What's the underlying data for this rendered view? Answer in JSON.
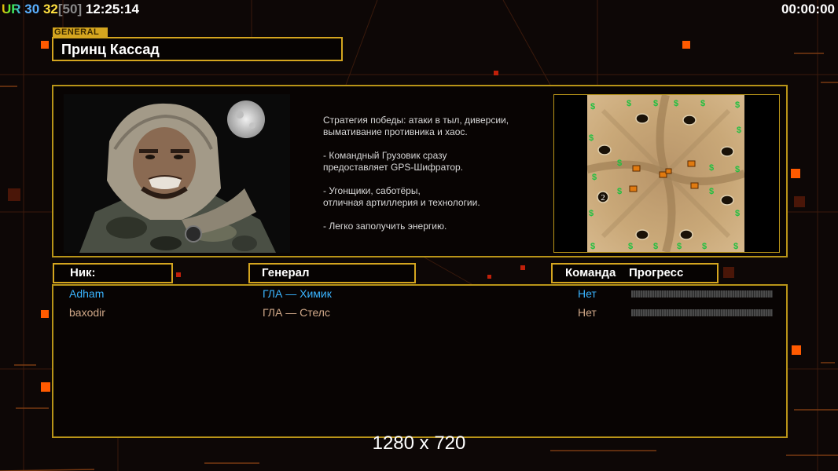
{
  "hud": {
    "prefix": "UR",
    "value_a": "30",
    "value_b": "32",
    "bracket_value": "[50]",
    "clock": "12:25:14",
    "timer": "00:00:00"
  },
  "general": {
    "tag": "GENERAL",
    "name": "Принц Кассад"
  },
  "description": [
    "Стратегия победы: атаки в тыл, диверсии,\n вымативание противника и хаос.",
    "- Командный Грузовик сразу\nпредоставляет GPS-Шифратор.",
    "- Угонщики, саботёры,\nотличная артиллерия и технологии.",
    "- Легко заполучить энергию."
  ],
  "map": {
    "player_marker": "2"
  },
  "columns": {
    "nick": "Ник:",
    "general": "Генерал",
    "team": "Команда",
    "progress": "Прогресс"
  },
  "players": [
    {
      "nick": "Adham",
      "general": "ГЛА — Химик",
      "ready": "Нет",
      "color": "#3ab4ff"
    },
    {
      "nick": "baxodir",
      "general": "ГЛА — Стелс",
      "ready": "Нет",
      "color": "#d0a888"
    }
  ],
  "resolution_label": "1280 x 720",
  "colors": {
    "accent": "#d4a51f",
    "player1": "#3ab4ff",
    "player2": "#d0a888"
  }
}
